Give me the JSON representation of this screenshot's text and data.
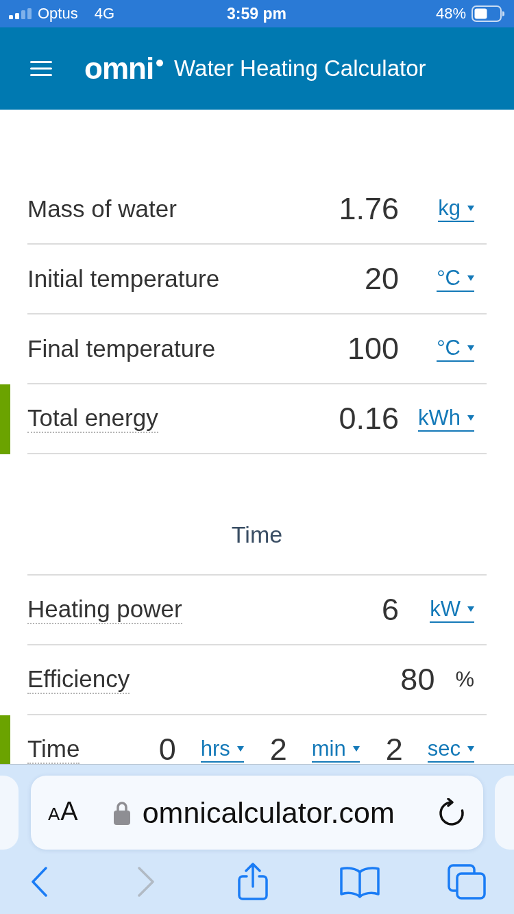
{
  "status_bar": {
    "carrier": "Optus",
    "network": "4G",
    "time": "3:59 pm",
    "battery": "48%"
  },
  "header": {
    "logo": "omni",
    "title": "Water Heating Calculator"
  },
  "sections": [
    {
      "rows": [
        {
          "label": "Mass of water",
          "tooltip": false,
          "highlighted": false,
          "fields": [
            {
              "value": "1.76",
              "unit": "kg",
              "dropdown": true
            }
          ]
        },
        {
          "label": "Initial temperature",
          "tooltip": false,
          "highlighted": false,
          "fields": [
            {
              "value": "20",
              "unit": "°C",
              "dropdown": true
            }
          ]
        },
        {
          "label": "Final temperature",
          "tooltip": false,
          "highlighted": false,
          "fields": [
            {
              "value": "100",
              "unit": "°C",
              "dropdown": true
            }
          ]
        },
        {
          "label": "Total energy",
          "tooltip": true,
          "highlighted": true,
          "fields": [
            {
              "value": "0.16",
              "unit": "kWh",
              "dropdown": true
            }
          ]
        }
      ]
    },
    {
      "heading": "Time",
      "rows": [
        {
          "label": "Heating power",
          "tooltip": true,
          "highlighted": false,
          "fields": [
            {
              "value": "6",
              "unit": "kW",
              "dropdown": true
            }
          ]
        },
        {
          "label": "Efficiency",
          "tooltip": true,
          "highlighted": false,
          "fields": [
            {
              "value": "80",
              "unit": "%",
              "dropdown": false
            }
          ]
        },
        {
          "label": "Time",
          "tooltip": true,
          "highlighted": true,
          "fields": [
            {
              "value": "0",
              "unit": "hrs",
              "dropdown": true
            },
            {
              "value": "2",
              "unit": "min",
              "dropdown": true
            },
            {
              "value": "2",
              "unit": "sec",
              "dropdown": true
            }
          ]
        }
      ]
    }
  ],
  "browser": {
    "text_size_button": "AA",
    "address": "omnicalculator.com",
    "toolbar": [
      {
        "kind": "back",
        "disabled": false
      },
      {
        "kind": "forward",
        "disabled": true
      },
      {
        "kind": "share",
        "disabled": false
      },
      {
        "kind": "bookmarks",
        "disabled": false
      },
      {
        "kind": "tabs",
        "disabled": false
      }
    ]
  }
}
